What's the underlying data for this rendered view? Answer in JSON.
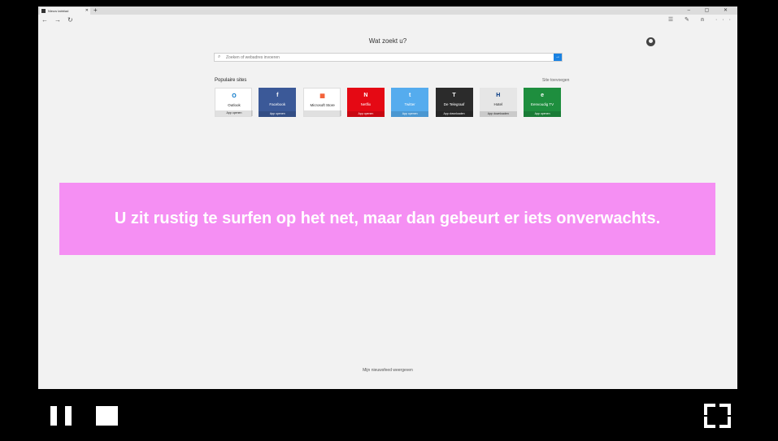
{
  "browser": {
    "tab_title": "Nieuw tabblad",
    "newtab": "+",
    "window_controls": "–  ▢  ✕",
    "nav_back": "←",
    "nav_forward": "→",
    "nav_refresh": "↻",
    "nav_right": "☰ ✎ ⍝ ···"
  },
  "page": {
    "title": "Wat zoekt u?",
    "search_placeholder": "Zoeken of webadres invoeren",
    "search_go": "→",
    "sites_heading": "Populaire sites",
    "sites_more": "Site toevoegen",
    "footer": "Mijn nieuwsfeed weergeven"
  },
  "tiles": [
    {
      "name": "Outlook",
      "bottom": "App openen",
      "icon": "O",
      "bg": "#ffffff",
      "fg": "#0072c6",
      "text": "#222"
    },
    {
      "name": "Facebook",
      "bottom": "App openen",
      "icon": "f",
      "bg": "#3b5998",
      "fg": "#ffffff",
      "text": "#fff"
    },
    {
      "name": "Microsoft Store",
      "bottom": "",
      "icon": "▦",
      "bg": "#ffffff",
      "fg": "#f25022",
      "text": "#222"
    },
    {
      "name": "Netflix",
      "bottom": "App openen",
      "icon": "N",
      "bg": "#e50914",
      "fg": "#ffffff",
      "text": "#fff"
    },
    {
      "name": "Twitter",
      "bottom": "App openen",
      "icon": "t",
      "bg": "#55acee",
      "fg": "#ffffff",
      "text": "#fff"
    },
    {
      "name": "De Telegraaf",
      "bottom": "App downloaden",
      "icon": "T",
      "bg": "#2b2b2b",
      "fg": "#ffffff",
      "text": "#fff"
    },
    {
      "name": "Hotel",
      "bottom": "App downloaden",
      "icon": "H",
      "bg": "#e6e6e6",
      "fg": "#003580",
      "text": "#222"
    },
    {
      "name": "Eenvoudig TV",
      "bottom": "App openen",
      "icon": "e",
      "bg": "#1e8e3e",
      "fg": "#ffffff",
      "text": "#fff"
    }
  ],
  "overlay": {
    "message": "U zit rustig te surfen op het net, maar dan gebeurt er iets onverwachts."
  }
}
